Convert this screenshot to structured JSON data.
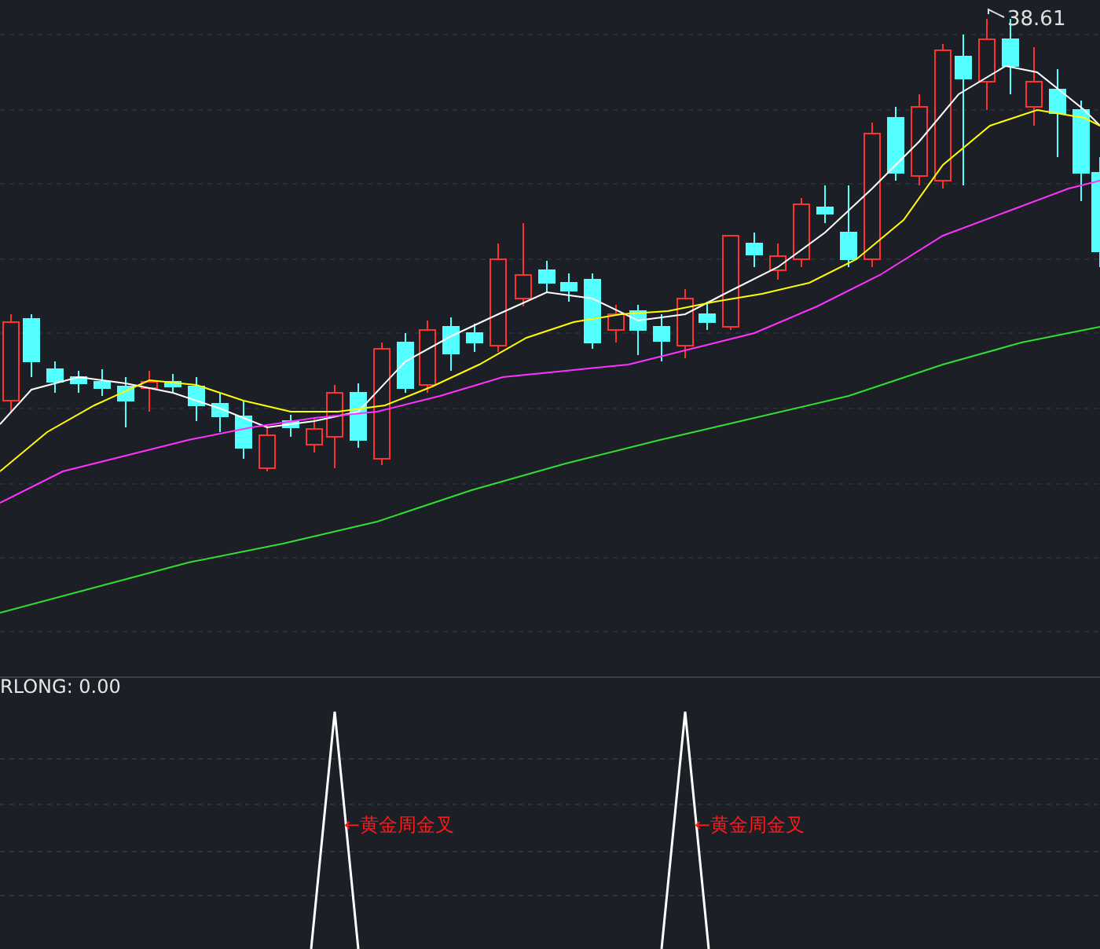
{
  "price_chart": {
    "high_label": "38.61"
  },
  "indicator": {
    "label": "RLONG: 0.00",
    "signals": [
      {
        "label": "←黄金周金叉"
      },
      {
        "label": "←黄金周金叉"
      }
    ]
  }
}
